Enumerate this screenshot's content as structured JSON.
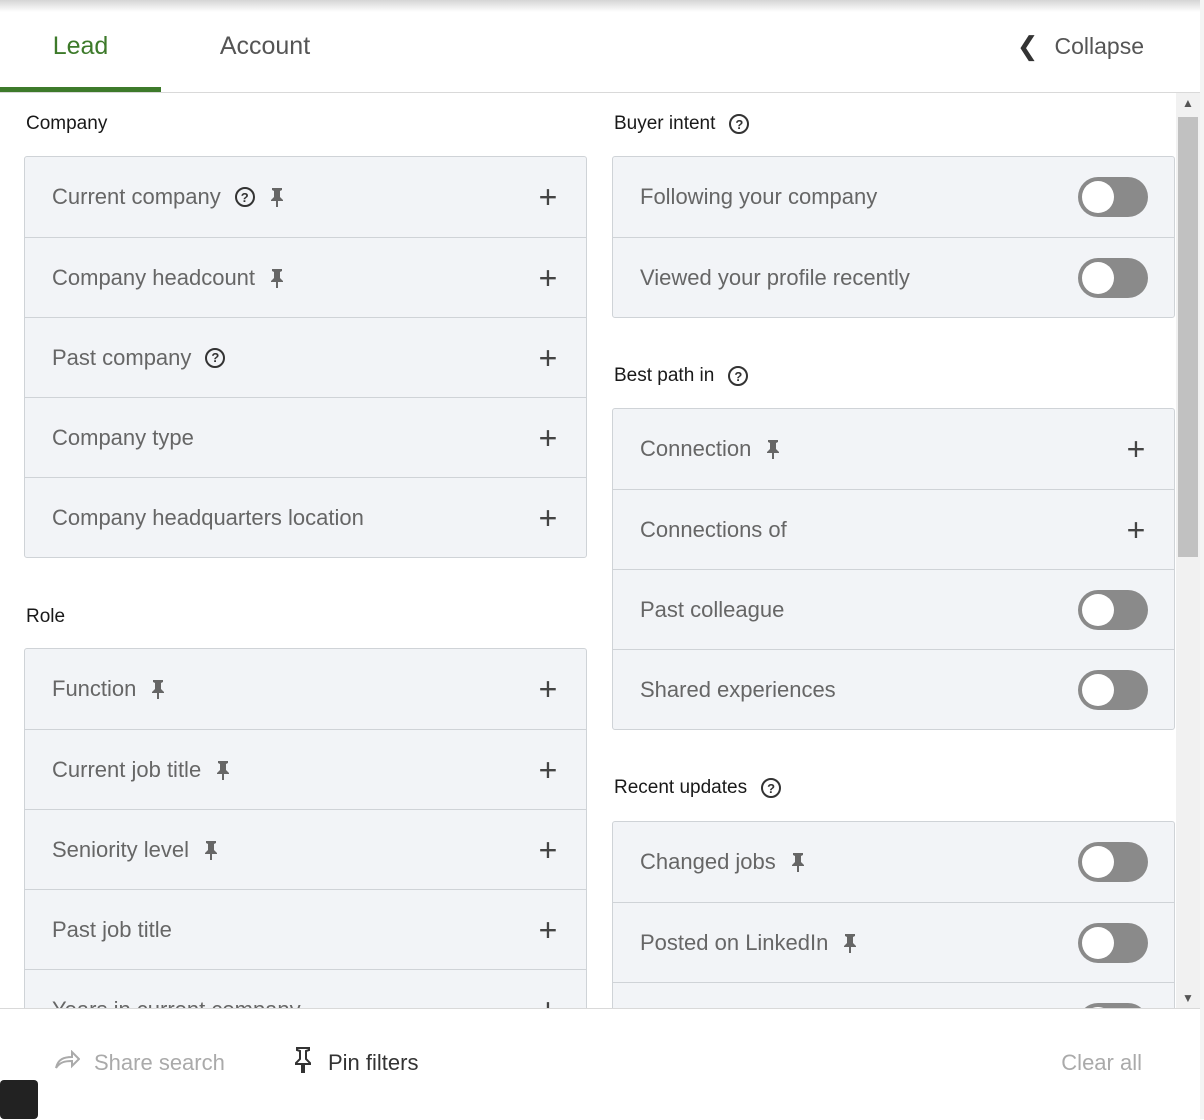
{
  "tabs": {
    "lead": "Lead",
    "account": "Account",
    "collapse": "Collapse"
  },
  "left": {
    "company_title": "Company",
    "company_items": [
      {
        "label": "Current company",
        "help": true,
        "pin": true
      },
      {
        "label": "Company headcount",
        "help": false,
        "pin": true
      },
      {
        "label": "Past company",
        "help": true,
        "pin": false
      },
      {
        "label": "Company type",
        "help": false,
        "pin": false
      },
      {
        "label": "Company headquarters location",
        "help": false,
        "pin": false
      }
    ],
    "role_title": "Role",
    "role_items": [
      {
        "label": "Function",
        "pin": true
      },
      {
        "label": "Current job title",
        "pin": true
      },
      {
        "label": "Seniority level",
        "pin": true
      },
      {
        "label": "Past job title",
        "pin": false
      },
      {
        "label": "Years in current company",
        "pin": false
      }
    ]
  },
  "right": {
    "buyer_title": "Buyer intent",
    "buyer_items": [
      {
        "label": "Following your company",
        "checked": false
      },
      {
        "label": "Viewed your profile recently",
        "checked": false
      }
    ],
    "path_title": "Best path in",
    "path_items": [
      {
        "label": "Connection",
        "pin": true,
        "type": "plus"
      },
      {
        "label": "Connections of",
        "pin": false,
        "type": "plus"
      },
      {
        "label": "Past colleague",
        "pin": false,
        "type": "toggle"
      },
      {
        "label": "Shared experiences",
        "pin": false,
        "type": "toggle"
      }
    ],
    "updates_title": "Recent updates",
    "updates_items": [
      {
        "label": "Changed jobs",
        "pin": true
      },
      {
        "label": "Posted on LinkedIn",
        "pin": true
      },
      {
        "label": "",
        "pin": false
      }
    ]
  },
  "footer": {
    "share": "Share search",
    "pin": "Pin filters",
    "clear": "Clear all"
  },
  "colors": {
    "accent": "#3d7a2a",
    "toggle_off": "#8a8a8a",
    "panel_bg": "#f2f4f7"
  },
  "icons": {
    "help": "question-circle-icon",
    "pin": "pin-icon",
    "plus": "plus-icon",
    "share": "share-arrow-icon",
    "collapse": "chevron-left-icon"
  }
}
